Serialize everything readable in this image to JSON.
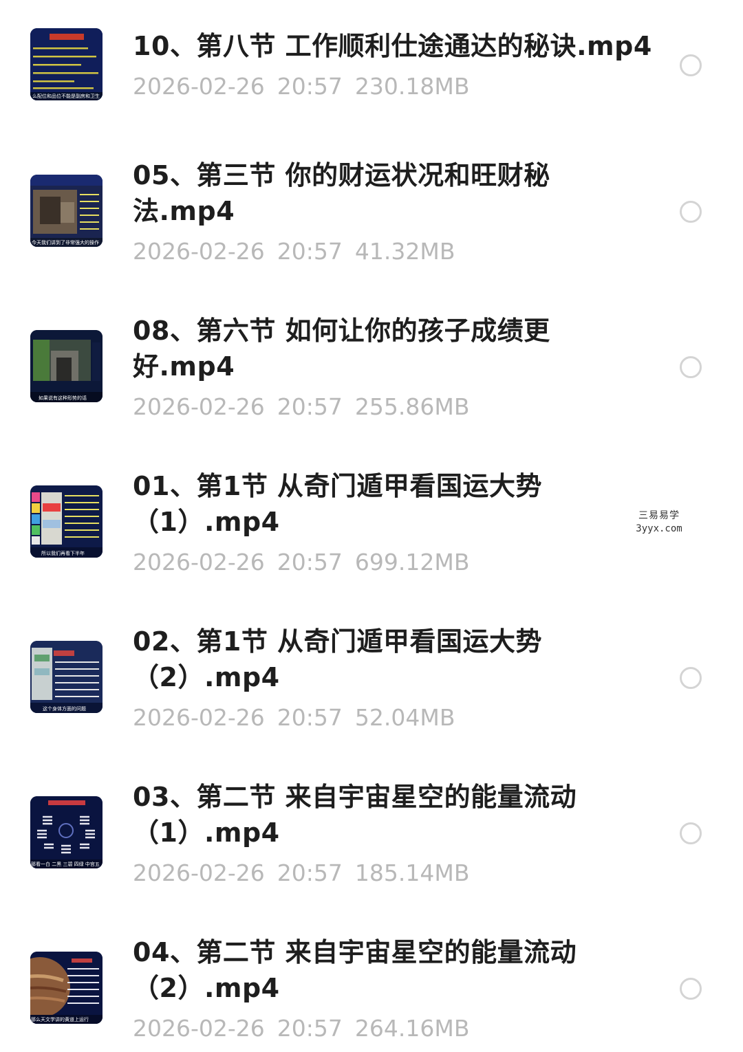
{
  "files": [
    {
      "name_line1": "10、第八节 工作顺利仕途通达的秘诀.mp4",
      "name_line2": "",
      "date": "2026-02-26",
      "time": "20:57",
      "size": "230.18MB",
      "thumb_caption": "么配位和品位不能是副房和卫生",
      "thumb_title": "内测培训讲师"
    },
    {
      "name_line1": "05、第三节 你的财运状况和旺财秘",
      "name_line2": "法.mp4",
      "date": "2026-02-26",
      "time": "20:57",
      "size": "41.32MB",
      "thumb_caption": "今天我们讲到了非常强大的操作",
      "thumb_title": "西正宿方位财喜岁令"
    },
    {
      "name_line1": "08、第六节 如何让你的孩子成绩更",
      "name_line2": "好.mp4",
      "date": "2026-02-26",
      "time": "20:57",
      "size": "255.86MB",
      "thumb_caption": "如果说有这种形势的话",
      "thumb_title": ""
    },
    {
      "name_line1": "01、第1节 从奇门遁甲看国运大势",
      "name_line2": "（1）.mp4",
      "date": "2026-02-26",
      "time": "20:57",
      "size": "699.12MB",
      "thumb_caption": "所以我们再看下半年",
      "thumb_title": ""
    },
    {
      "name_line1": "02、第1节 从奇门遁甲看国运大势",
      "name_line2": "（2）.mp4",
      "date": "2026-02-26",
      "time": "20:57",
      "size": "52.04MB",
      "thumb_caption": "这个身体方面的问题",
      "thumb_title": ""
    },
    {
      "name_line1": "03、第二节 来自宇宙星空的能量流动",
      "name_line2": "（1）.mp4",
      "date": "2026-02-26",
      "time": "20:57",
      "size": "185.14MB",
      "thumb_caption": "那看一白 二黑 三碧 四绿 中宫五",
      "thumb_title": ""
    },
    {
      "name_line1": "04、第二节 来自宇宙星空的能量流动",
      "name_line2": "（2）.mp4",
      "date": "2026-02-26",
      "time": "20:57",
      "size": "264.16MB",
      "thumb_caption": "那么天文学讲的黄道上运行",
      "thumb_title": ""
    }
  ],
  "watermark": {
    "line1": "三易易学",
    "line2": "3yyx.com"
  },
  "colors": {
    "title": "#1e1e1e",
    "meta": "#b8b8b8",
    "radio_border": "#d4d4d4"
  }
}
